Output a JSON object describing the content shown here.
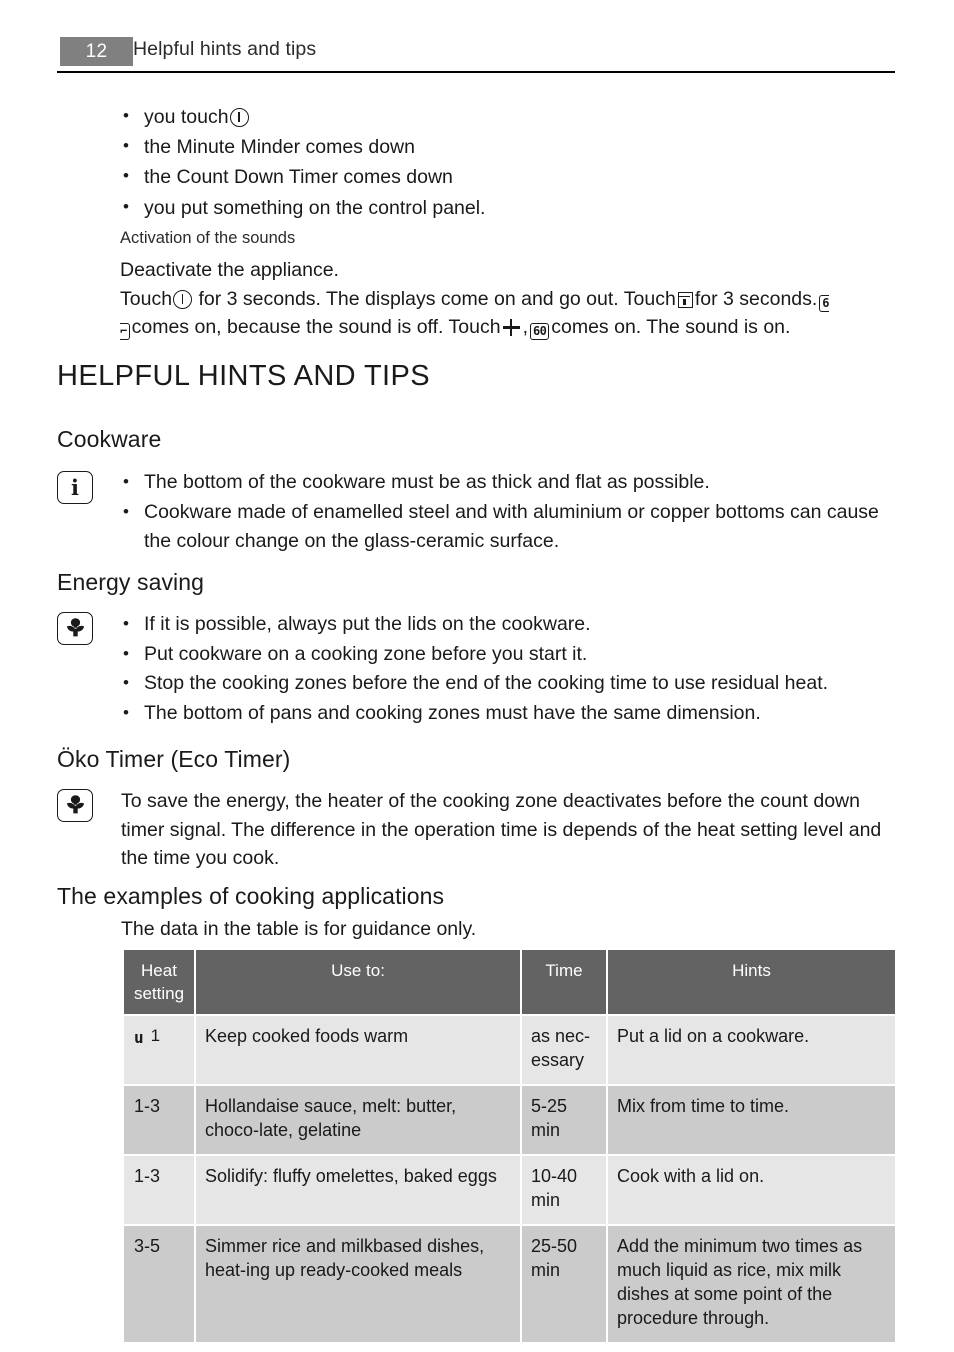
{
  "page_header": {
    "page_number": "12",
    "section_title": "Helpful hints and tips"
  },
  "intro": {
    "bullets": [
      "you touch",
      "the Minute Minder comes down",
      "the Count Down Timer comes down",
      "you put something on the control panel."
    ],
    "bullet_0_icon": "power-icon",
    "sub_caption": "Activation of the sounds",
    "deactivate_line": "Deactivate the appliance.",
    "touch_text_1": "Touch",
    "touch_text_2": "for 3 seconds. The displays come on and go out. Touch",
    "touch_text_3": "for 3 seconds.",
    "touch_text_4": "comes on, because the sound is off. Touch",
    "touch_text_5": ",",
    "touch_text_6": "comes on. The sound is on.",
    "display_off": "6 ⌐",
    "display_60": "60"
  },
  "main_heading": "HELPFUL HINTS AND TIPS",
  "sections": {
    "cookware": {
      "heading": "Cookware",
      "icon": "info-icon",
      "icon_glyph": "i",
      "bullets": [
        "The bottom of the cookware must be as thick and flat as possible.",
        "Cookware made of enamelled steel and with aluminium or copper bottoms can cause the colour change on the glass-ceramic surface."
      ]
    },
    "energy_saving": {
      "heading": "Energy saving",
      "icon": "eco-flower-icon",
      "bullets": [
        "If it is possible, always put the lids on the cookware.",
        "Put cookware on a cooking zone before you start it.",
        "Stop the cooking zones before the end of the cooking time to use residual heat.",
        "The bottom of pans and cooking zones must have the same dimension."
      ]
    },
    "oko_timer": {
      "heading": "Öko Timer (Eco Timer)",
      "icon": "eco-flower-icon",
      "paragraph": "To save the energy, the heater of the cooking zone deactivates before the count down timer signal. The difference in the operation time is depends of the heat setting level and the time you cook."
    },
    "examples": {
      "heading": "The examples of cooking applications",
      "intro": "The data in the table is for guidance only."
    }
  },
  "table": {
    "headers": {
      "heat": "Heat setting",
      "use": "Use to:",
      "time": "Time",
      "hints": "Hints"
    },
    "rows": [
      {
        "heat_symbol": "u",
        "heat": "1",
        "use": "Keep cooked foods warm",
        "time": "as nec-essary",
        "hints": "Put a lid on a cookware.",
        "shade": "light"
      },
      {
        "heat_symbol": "",
        "heat": "1-3",
        "use": "Hollandaise sauce, melt: butter, choco-late, gelatine",
        "time": "5-25 min",
        "hints": "Mix from time to time.",
        "shade": "dark"
      },
      {
        "heat_symbol": "",
        "heat": "1-3",
        "use": "Solidify: fluffy omelettes, baked eggs",
        "time": "10-40 min",
        "hints": "Cook with a lid on.",
        "shade": "light"
      },
      {
        "heat_symbol": "",
        "heat": "3-5",
        "use": "Simmer rice and milkbased dishes, heat-ing up ready-cooked meals",
        "time": "25-50 min",
        "hints": "Add the minimum two times as much liquid as rice, mix milk dishes at some point of the procedure through.",
        "shade": "dark"
      }
    ]
  },
  "colors": {
    "badge": "#808080",
    "table_header": "#636363",
    "row_light": "#e6e6e6",
    "row_dark": "#cbcbcb",
    "text": "#1a1a1a"
  }
}
